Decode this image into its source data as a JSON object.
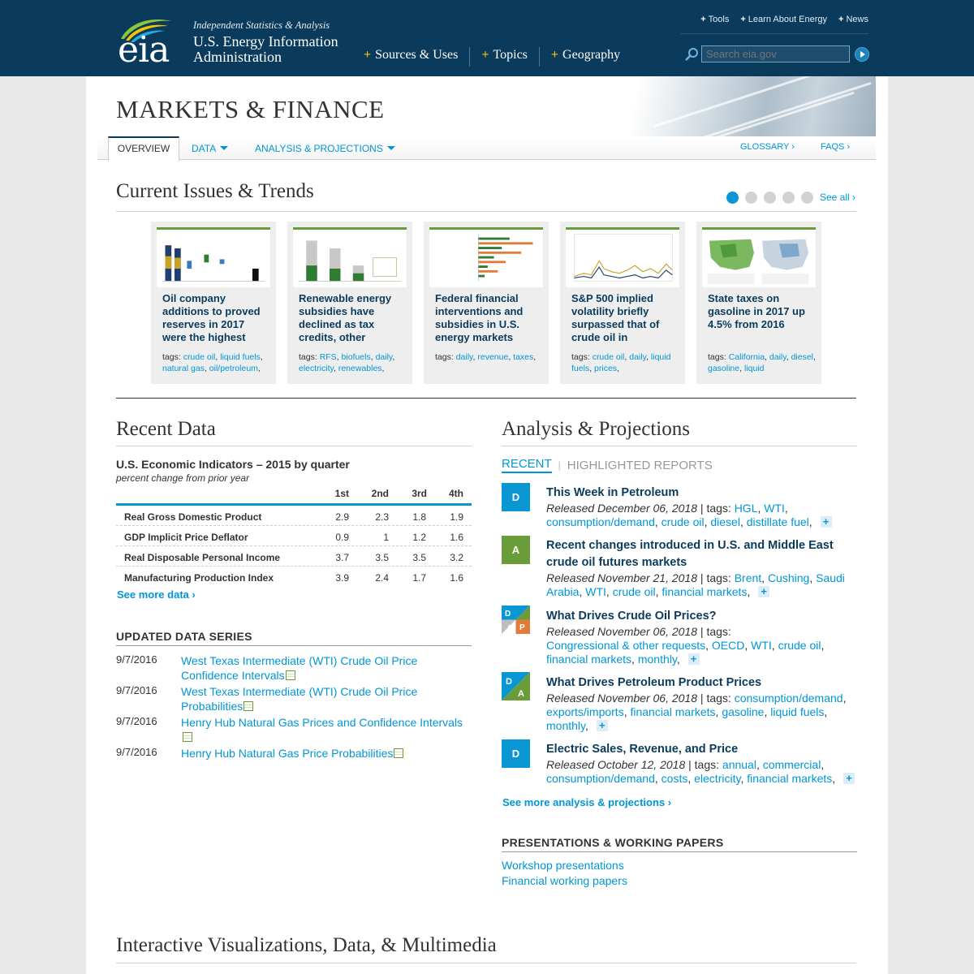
{
  "header": {
    "logo_text": "eia",
    "tagline": "Independent Statistics & Analysis",
    "org_name": "U.S. Energy Information Administration",
    "main_nav": [
      "Sources & Uses",
      "Topics",
      "Geography"
    ],
    "util_nav": [
      "Tools",
      "Learn About Energy",
      "News"
    ],
    "search_placeholder": "Search eia.gov"
  },
  "page": {
    "title": "MARKETS & FINANCE",
    "subnav": {
      "overview": "OVERVIEW",
      "data": "DATA",
      "analysis": "ANALYSIS & PROJECTIONS",
      "glossary": "GLOSSARY ›",
      "faqs": "FAQS ›"
    }
  },
  "current_issues": {
    "title": "Current Issues & Trends",
    "see_all": "See all ›",
    "cards": [
      {
        "title": "Oil company additions to proved reserves in 2017 were the highest",
        "tags": [
          "crude oil",
          "liquid fuels",
          "natural gas",
          "oil/petroleum"
        ]
      },
      {
        "title": "Renewable energy subsidies have declined as tax credits, other",
        "tags": [
          "RFS",
          "biofuels",
          "daily",
          "electricity",
          "renewables"
        ]
      },
      {
        "title": "Federal financial interventions and subsidies in U.S. energy markets",
        "tags": [
          "daily",
          "revenue",
          "taxes"
        ]
      },
      {
        "title": "S&P 500 implied volatility briefly surpassed that of crude oil in",
        "tags": [
          "crude oil",
          "daily",
          "liquid fuels",
          "prices"
        ]
      },
      {
        "title": "State taxes on gasoline in 2017 up 4.5% from 2016",
        "tags": [
          "California",
          "daily",
          "diesel",
          "gasoline",
          "liquid"
        ]
      }
    ],
    "tags_label": "tags:"
  },
  "recent_data": {
    "title": "Recent Data",
    "table_title": "U.S. Economic Indicators – 2015 by quarter",
    "table_subtitle": "percent change from prior year",
    "columns": [
      "1st",
      "2nd",
      "3rd",
      "4th"
    ],
    "rows": [
      {
        "label": "Real Gross Domestic Product",
        "values": [
          "2.9",
          "2.3",
          "1.8",
          "1.9"
        ]
      },
      {
        "label": "GDP Implicit Price Deflator",
        "values": [
          "0.9",
          "1",
          "1.2",
          "1.6"
        ]
      },
      {
        "label": "Real Disposable Personal Income",
        "values": [
          "3.7",
          "3.5",
          "3.5",
          "3.2"
        ]
      },
      {
        "label": "Manufacturing Production Index",
        "values": [
          "3.9",
          "2.4",
          "1.7",
          "1.6"
        ]
      }
    ],
    "see_more": "See more data ›",
    "updated_title": "UPDATED DATA SERIES",
    "updated": [
      {
        "date": "9/7/2016",
        "text": "West Texas Intermediate (WTI) Crude Oil Price Confidence Intervals"
      },
      {
        "date": "9/7/2016",
        "text": "West Texas Intermediate (WTI) Crude Oil Price Probabilities"
      },
      {
        "date": "9/7/2016",
        "text": "Henry Hub Natural Gas Prices and Confidence Intervals"
      },
      {
        "date": "9/7/2016",
        "text": "Henry Hub Natural Gas Price Probabilities"
      }
    ]
  },
  "analysis": {
    "title": "Analysis & Projections",
    "tab_recent": "RECENT",
    "tab_highlighted": "HIGHLIGHTED REPORTS",
    "items": [
      {
        "badge": "D",
        "title": "This Week in Petroleum",
        "released": "Released December 06, 2018",
        "tags": [
          "HGL",
          "WTI",
          "consumption/demand",
          "crude oil",
          "diesel",
          "distillate fuel"
        ]
      },
      {
        "badge": "A",
        "title": "Recent changes introduced in U.S. and Middle East crude oil futures markets",
        "released": "Released November 21, 2018",
        "tags": [
          "Brent",
          "Cushing",
          "Saudi Arabia",
          "WTI",
          "crude oil",
          "financial markets"
        ]
      },
      {
        "badge": "DAPA",
        "title": "What Drives Crude Oil Prices?",
        "released": "Released November 06, 2018",
        "tags": [
          "Congressional & other requests",
          "OECD",
          "WTI",
          "crude oil",
          "financial markets",
          "monthly"
        ]
      },
      {
        "badge": "DA",
        "title": "What Drives Petroleum Product Prices",
        "released": "Released November 06, 2018",
        "tags": [
          "consumption/demand",
          "exports/imports",
          "financial markets",
          "gasoline",
          "liquid fuels",
          "monthly"
        ]
      },
      {
        "badge": "D",
        "title": "Electric Sales, Revenue, and Price",
        "released": "Released October 12, 2018",
        "tags": [
          "annual",
          "commercial",
          "consumption/demand",
          "costs",
          "electricity",
          "financial markets"
        ]
      }
    ],
    "tags_label": "tags:",
    "see_more": "See more analysis & projections ›",
    "presentations_title": "PRESENTATIONS & WORKING PAPERS",
    "presentations": [
      "Workshop presentations",
      "Financial working papers"
    ]
  },
  "interactive": {
    "title": "Interactive Visualizations, Data, & Multimedia"
  },
  "colors": {
    "header_bg": "#0a3b5c",
    "accent_blue": "#0096d6",
    "green": "#6a9c3a",
    "yellow": "#f5c300"
  }
}
